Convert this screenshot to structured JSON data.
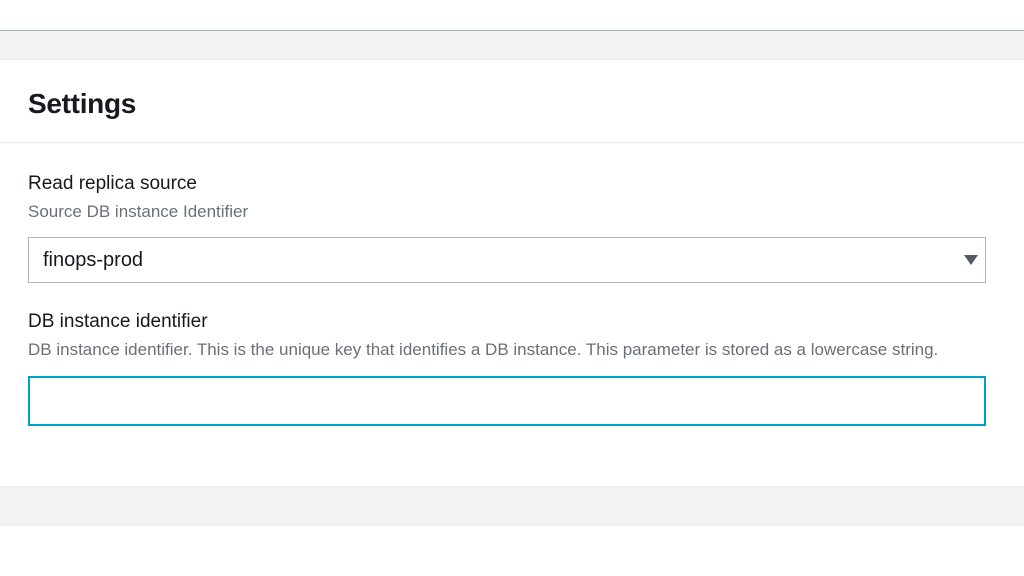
{
  "panel": {
    "title": "Settings"
  },
  "replicaSource": {
    "label": "Read replica source",
    "description": "Source DB instance Identifier",
    "value": "finops-prod"
  },
  "dbIdentifier": {
    "label": "DB instance identifier",
    "description": "DB instance identifier. This is the unique key that identifies a DB instance. This parameter is stored as a lowercase string.",
    "value": ""
  }
}
